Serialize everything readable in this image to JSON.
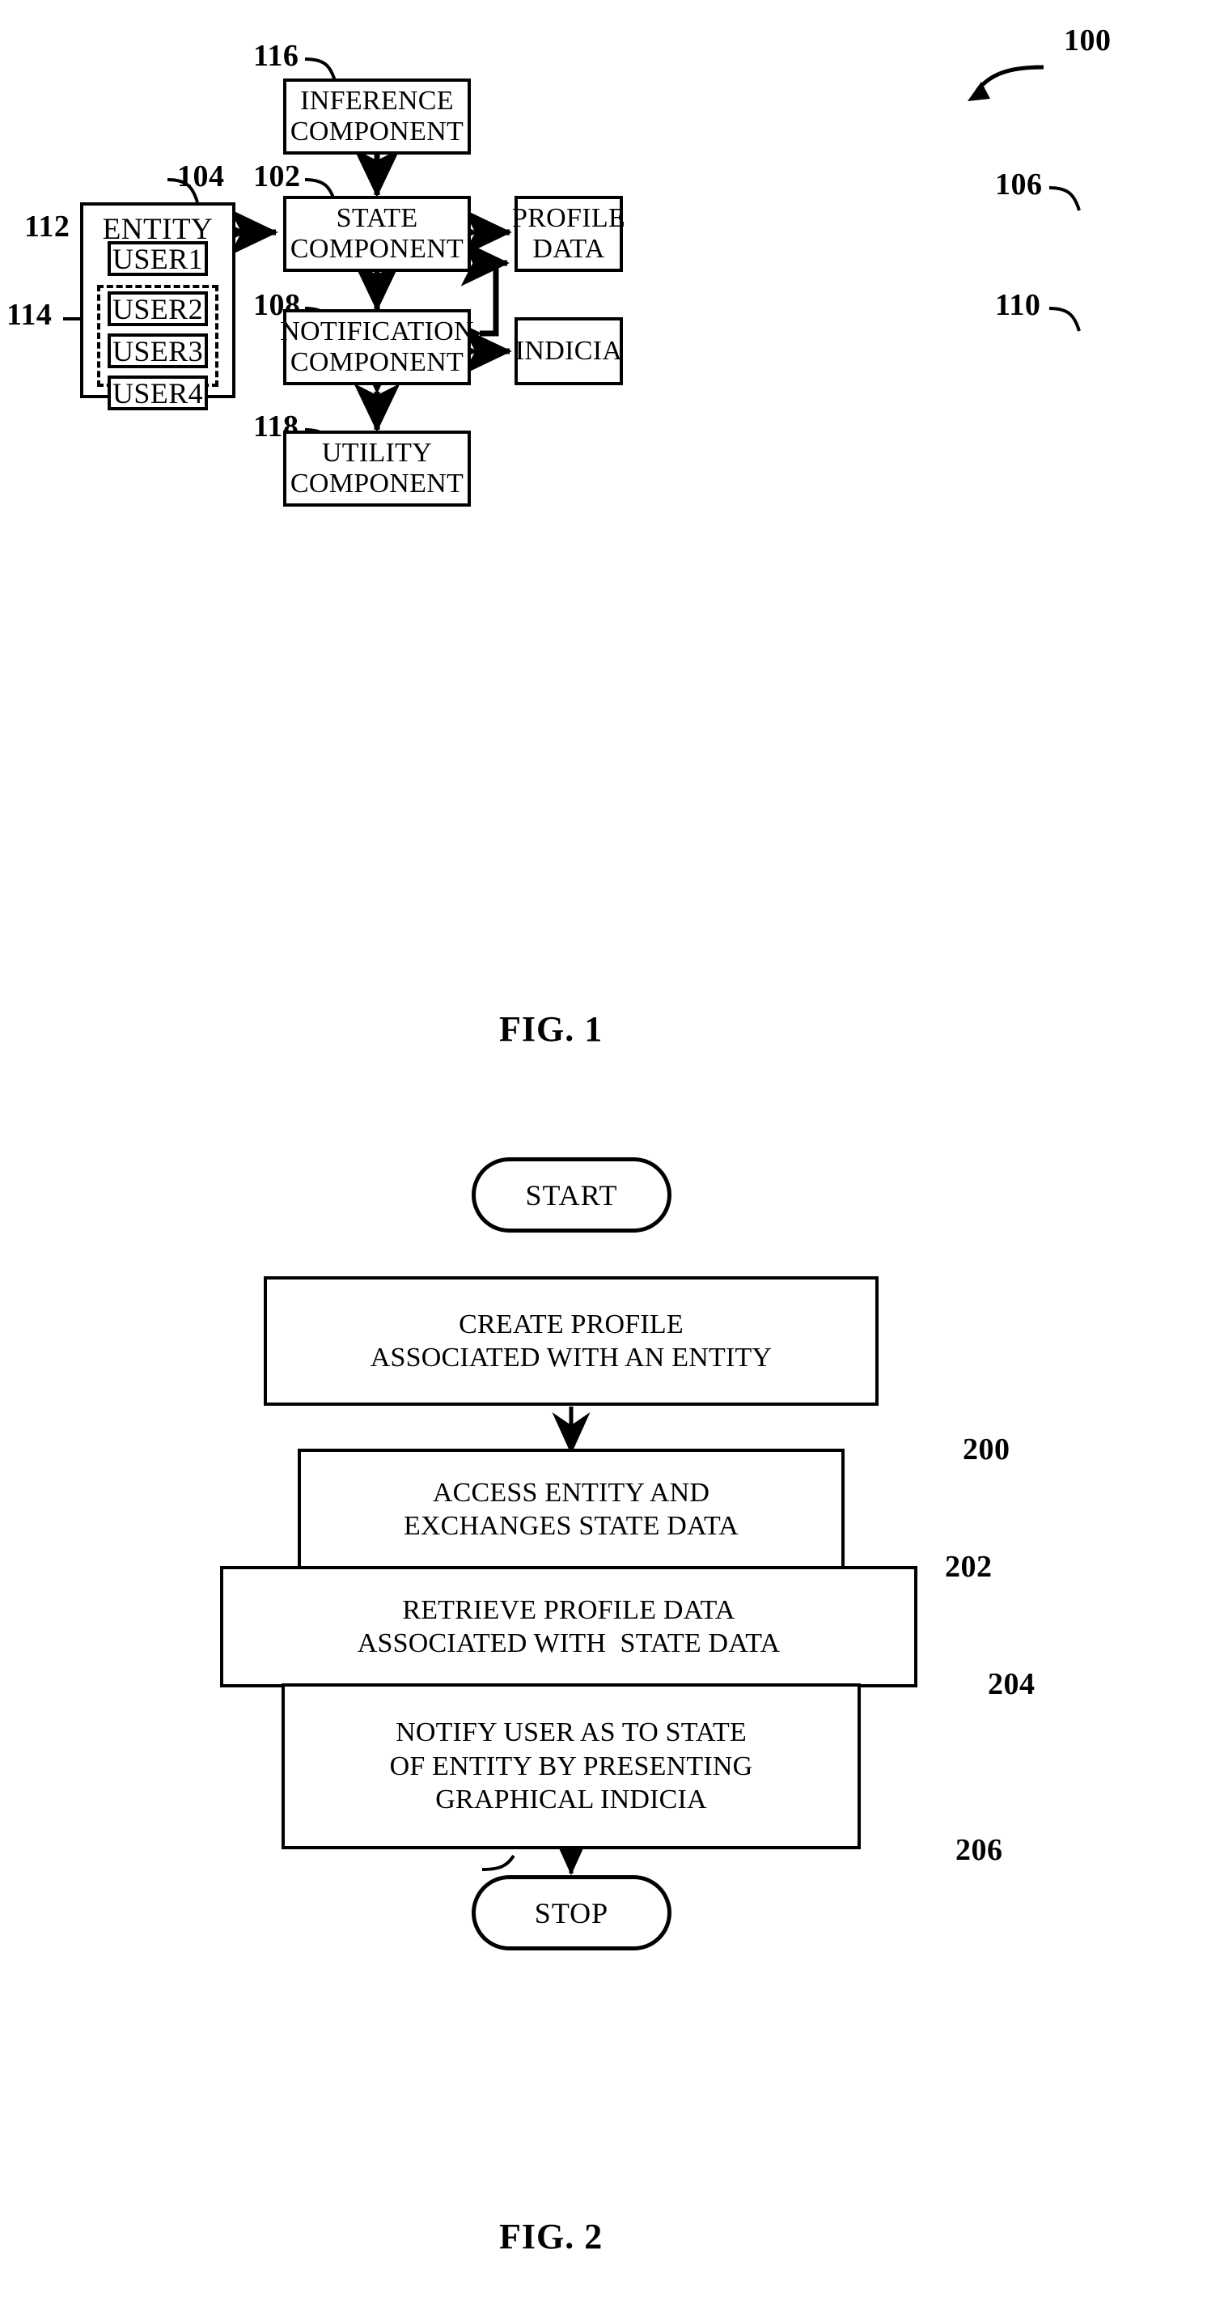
{
  "document": {
    "type": "patent-drawing-sheet",
    "figures": [
      "FIG. 1",
      "FIG. 2"
    ]
  },
  "fig1": {
    "caption": "FIG. 1",
    "system_ref": "100",
    "nodes": {
      "inference": {
        "ref": "116",
        "line1": "INFERENCE",
        "line2": "COMPONENT"
      },
      "state": {
        "ref": "102",
        "line1": "STATE",
        "line2": "COMPONENT"
      },
      "notification": {
        "ref": "108",
        "line1": "NOTIFICATION",
        "line2": "COMPONENT"
      },
      "utility": {
        "ref": "118",
        "line1": "UTILITY",
        "line2": "COMPONENT"
      },
      "profile_data": {
        "ref": "106",
        "line1": "PROFILE",
        "line2": "DATA"
      },
      "indicia": {
        "ref": "110",
        "line1": "INDICIA",
        "line2": ""
      },
      "entity": {
        "ref": "104",
        "title": "ENTITY",
        "user1": {
          "ref": "112",
          "label": "USER1"
        },
        "group": {
          "ref": "114",
          "users": [
            {
              "label": "USER2"
            },
            {
              "label": "USER3"
            },
            {
              "label": "USER4"
            }
          ]
        }
      }
    }
  },
  "fig2": {
    "caption": "FIG. 2",
    "start": "START",
    "stop": "STOP",
    "steps": [
      {
        "ref": "200",
        "lines": [
          "CREATE PROFILE",
          "ASSOCIATED WITH AN ENTITY"
        ]
      },
      {
        "ref": "202",
        "lines": [
          "ACCESS ENTITY AND",
          "EXCHANGES STATE DATA"
        ]
      },
      {
        "ref": "204",
        "lines": [
          "RETRIEVE PROFILE DATA",
          "ASSOCIATED WITH  STATE DATA"
        ]
      },
      {
        "ref": "206",
        "lines": [
          "NOTIFY USER AS TO STATE",
          "OF ENTITY BY PRESENTING",
          "GRAPHICAL INDICIA"
        ]
      }
    ]
  },
  "colors": {
    "ink": "#000000",
    "paper": "#ffffff"
  }
}
